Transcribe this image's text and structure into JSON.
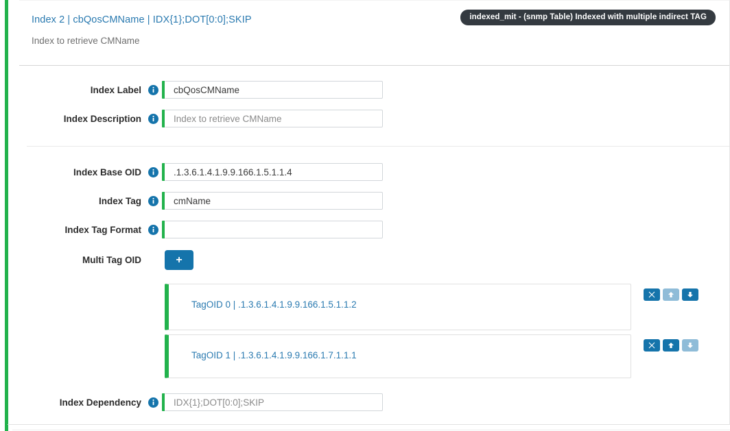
{
  "header": {
    "title": "Index 2 | cbQosCMName | IDX{1};DOT[0:0];SKIP",
    "subtitle": "Index to retrieve CMName",
    "badge": "indexed_mit - (snmp Table) Indexed with multiple indirect TAG"
  },
  "form": {
    "fields": [
      {
        "label": "Index Label",
        "value": "cbQosCMName",
        "placeholder": "",
        "is_placeholder": false,
        "info_icon": "info-icon"
      },
      {
        "label": "Index Description",
        "value": "Index to retrieve CMName",
        "placeholder": "Index to retrieve CMName",
        "is_placeholder": true,
        "info_icon": "info-icon"
      },
      {
        "label": "Index Base OID",
        "value": ".1.3.6.1.4.1.9.9.166.1.5.1.1.4",
        "placeholder": "",
        "is_placeholder": false,
        "info_icon": "info-icon"
      },
      {
        "label": "Index Tag",
        "value": "cmName",
        "placeholder": "",
        "is_placeholder": false,
        "info_icon": "info-icon"
      },
      {
        "label": "Index Tag Format",
        "value": "",
        "placeholder": "",
        "is_placeholder": false,
        "info_icon": "info-icon"
      },
      {
        "label": "Index Dependency",
        "value": "IDX{1};DOT[0:0];SKIP",
        "placeholder": "IDX{1};DOT[0:0];SKIP",
        "is_placeholder": true,
        "info_icon": "info-icon"
      }
    ],
    "multi_tag_oid": {
      "label": "Multi Tag OID",
      "add_button_label": "+",
      "add_button_icon": "plus-icon",
      "add_button_color": "#1574ab"
    }
  },
  "tag_oids": [
    {
      "text": "TagOID 0 | .1.3.6.1.4.1.9.9.166.1.5.1.1.2",
      "name": "TagOID 0",
      "oid": ".1.3.6.1.4.1.9.9.166.1.5.1.1.2",
      "actions": {
        "delete": {
          "icon": "close-icon",
          "label": "✖",
          "enabled": true
        },
        "move_up": {
          "icon": "arrow-up-icon",
          "label": "↑",
          "enabled": false
        },
        "move_down": {
          "icon": "arrow-down-icon",
          "label": "↓",
          "enabled": true
        }
      }
    },
    {
      "text": "TagOID 1 | .1.3.6.1.4.1.9.9.166.1.7.1.1.1",
      "name": "TagOID 1",
      "oid": ".1.3.6.1.4.1.9.9.166.1.7.1.1.1",
      "actions": {
        "delete": {
          "icon": "close-icon",
          "label": "✖",
          "enabled": true
        },
        "move_up": {
          "icon": "arrow-up-icon",
          "label": "↑",
          "enabled": true
        },
        "move_down": {
          "icon": "arrow-down-icon",
          "label": "↓",
          "enabled": false
        }
      }
    }
  ],
  "colors": {
    "accent_green": "#22b24c",
    "link_blue": "#2a7ab0",
    "button_blue": "#1574ab",
    "button_blue_disabled": "#8fbcd8",
    "badge_dark": "#343a40",
    "info_blue": "#1574ab"
  }
}
